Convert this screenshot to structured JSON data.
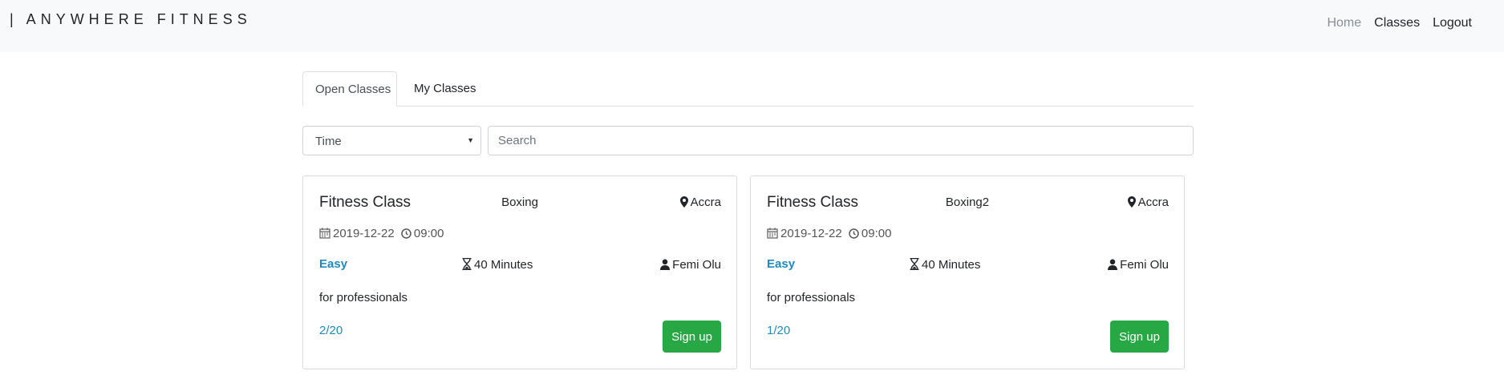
{
  "nav": {
    "brand": "| ANYWHERE FITNESS",
    "links": [
      "Home",
      "Classes",
      "Logout"
    ]
  },
  "tabs": [
    "Open Classes",
    "My Classes"
  ],
  "filter": {
    "select_value": "Time",
    "search_placeholder": "Search"
  },
  "cards": [
    {
      "title": "Fitness Class",
      "type": "Boxing",
      "location": "Accra",
      "date": "2019-12-22",
      "time": "09:00",
      "level": "Easy",
      "duration": "40 Minutes",
      "instructor": "Femi Olu",
      "description": "for professionals",
      "count": "2/20",
      "button": "Sign up"
    },
    {
      "title": "Fitness Class",
      "type": "Boxing2",
      "location": "Accra",
      "date": "2019-12-22",
      "time": "09:00",
      "level": "Easy",
      "duration": "40 Minutes",
      "instructor": "Femi Olu",
      "description": "for professionals",
      "count": "1/20",
      "button": "Sign up"
    }
  ],
  "colors": {
    "accent_blue": "#1f8bc2",
    "signup_green": "#28a745",
    "navbar_bg": "#f8f9fa"
  }
}
